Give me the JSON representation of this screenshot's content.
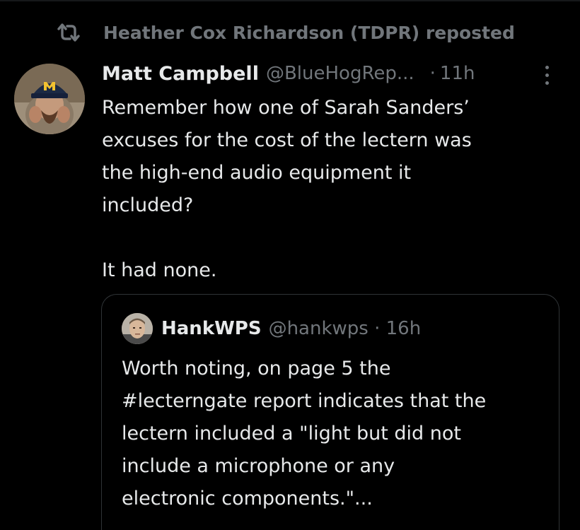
{
  "repost": {
    "label": "Heather Cox Richardson (TDPR) reposted",
    "icon": "repost-icon"
  },
  "post": {
    "author_name": "Matt Campbell",
    "author_handle": "@BlueHogRep...",
    "separator": "·",
    "time": "11h",
    "more_icon": "more-vertical-icon",
    "body_lines": [
      "Remember how one of Sarah Sanders’",
      "excuses for the cost of the lectern was",
      "the high-end audio equipment it",
      "included?"
    ],
    "body_tail": "It had none."
  },
  "quote": {
    "author_name": "HankWPS",
    "author_handle": "@hankwps · 16h",
    "body_lines": [
      "Worth noting, on page 5 the",
      "#lecterngate report indicates that the",
      "lectern included a \"light but did not",
      "include a microphone or any",
      "electronic components.\"..."
    ]
  },
  "colors": {
    "background": "#000000",
    "primary_text": "#e7e9ea",
    "secondary_text": "#71767b",
    "border": "#2f3336"
  }
}
